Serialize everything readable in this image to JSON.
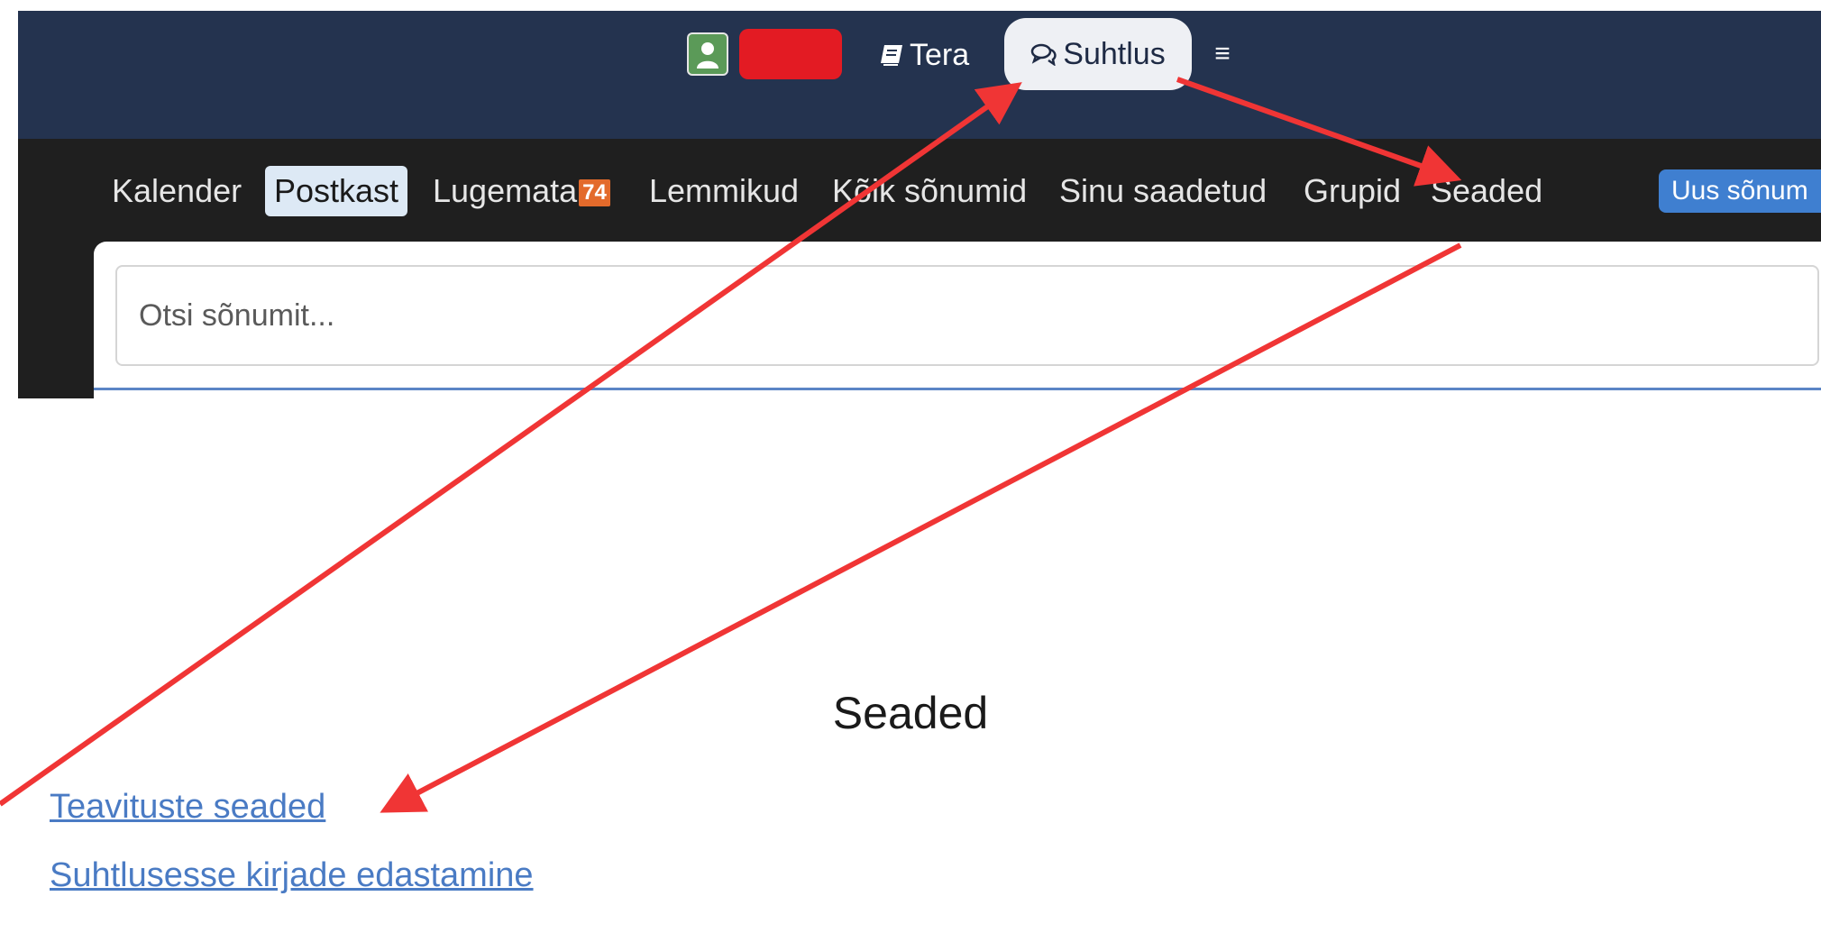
{
  "topbar": {
    "tera_label": "Tera",
    "suhtlus_label": "Suhtlus",
    "menu_glyph": "≡"
  },
  "nav": {
    "items": [
      {
        "label": "Kalender"
      },
      {
        "label": "Postkast"
      },
      {
        "label": "Lugemata"
      },
      {
        "label": "Lemmikud"
      },
      {
        "label": "Kõik sõnumid"
      },
      {
        "label": "Sinu saadetud"
      },
      {
        "label": "Grupid"
      },
      {
        "label": "Seaded"
      }
    ],
    "unread_count": "74",
    "new_message_label": "Uus sõnum"
  },
  "search": {
    "placeholder": "Otsi sõnumit..."
  },
  "settings": {
    "title": "Seaded",
    "links": [
      {
        "label": "Teavituste seaded"
      },
      {
        "label": "Suhtlusesse kirjade edastamine"
      }
    ]
  },
  "colors": {
    "topbar_bg": "#24334f",
    "navbar_bg": "#1f1f1f",
    "active_tab_bg": "#dde9f5",
    "badge_bg": "#e36a2b",
    "primary_button": "#3f7fd0",
    "link_color": "#4a7bc4",
    "annotation_arrow": "#f03535"
  },
  "icons": {
    "avatar": "user-avatar-icon",
    "tera": "book-icon",
    "suhtlus": "chat-bubbles-icon",
    "menu": "hamburger-icon"
  }
}
